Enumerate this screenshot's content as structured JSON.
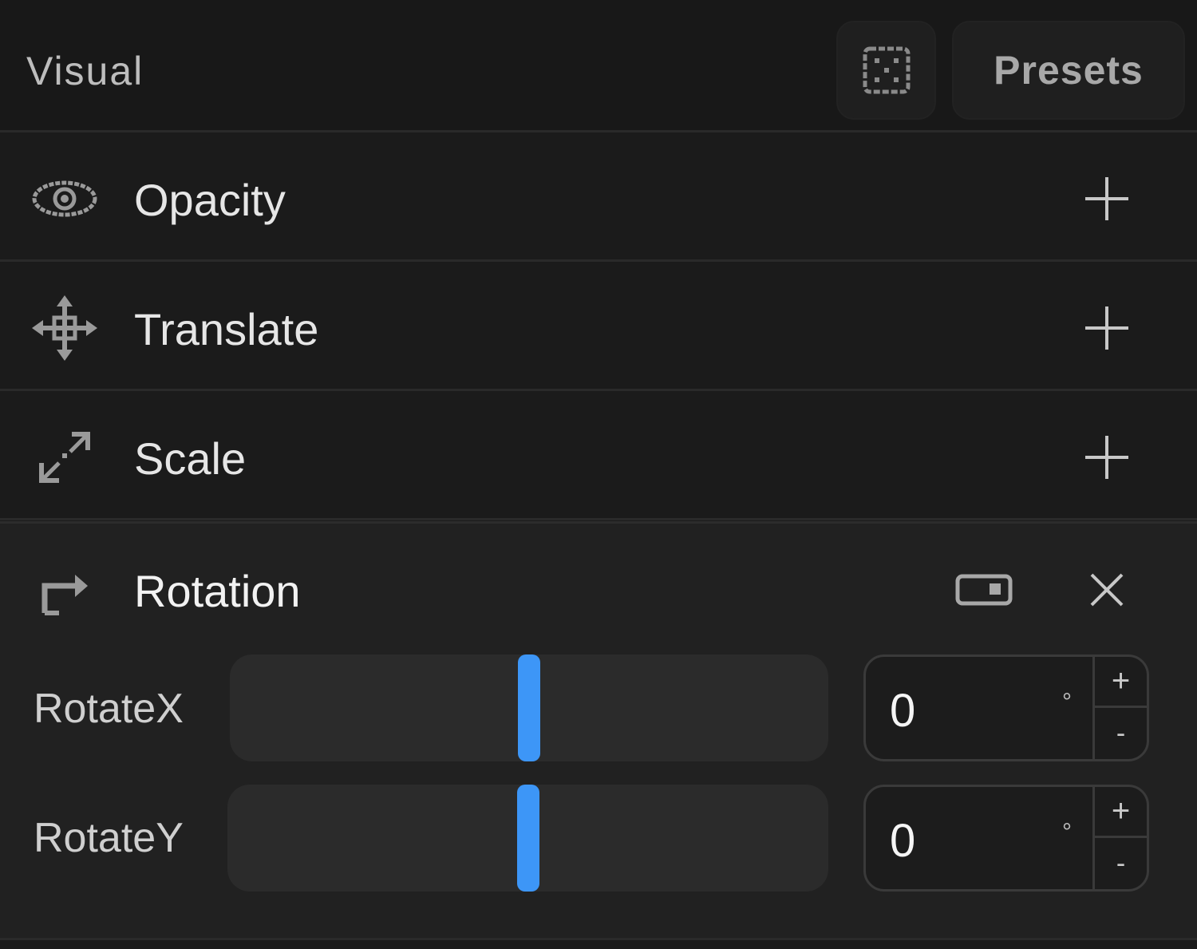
{
  "header": {
    "title": "Visual",
    "random_icon": "dice-icon",
    "presets_label": "Presets"
  },
  "rows": [
    {
      "label": "Opacity",
      "icon": "eye-icon"
    },
    {
      "label": "Translate",
      "icon": "move-arrows-icon"
    },
    {
      "label": "Scale",
      "icon": "scale-arrows-icon"
    }
  ],
  "rotation": {
    "label": "Rotation",
    "icon": "rotate-arrow-icon",
    "toggle_icon": "toggle-switch-icon",
    "close_icon": "close-icon",
    "axes": [
      {
        "label": "RotateX",
        "value": "0",
        "unit": "°",
        "increment": "+",
        "decrement": "-",
        "level": 0.5
      },
      {
        "label": "RotateY",
        "value": "0",
        "unit": "°",
        "increment": "+",
        "decrement": "-",
        "level": 0.5
      }
    ]
  },
  "colors": {
    "accent": "#3d96f7",
    "background": "#1b1b1b"
  }
}
